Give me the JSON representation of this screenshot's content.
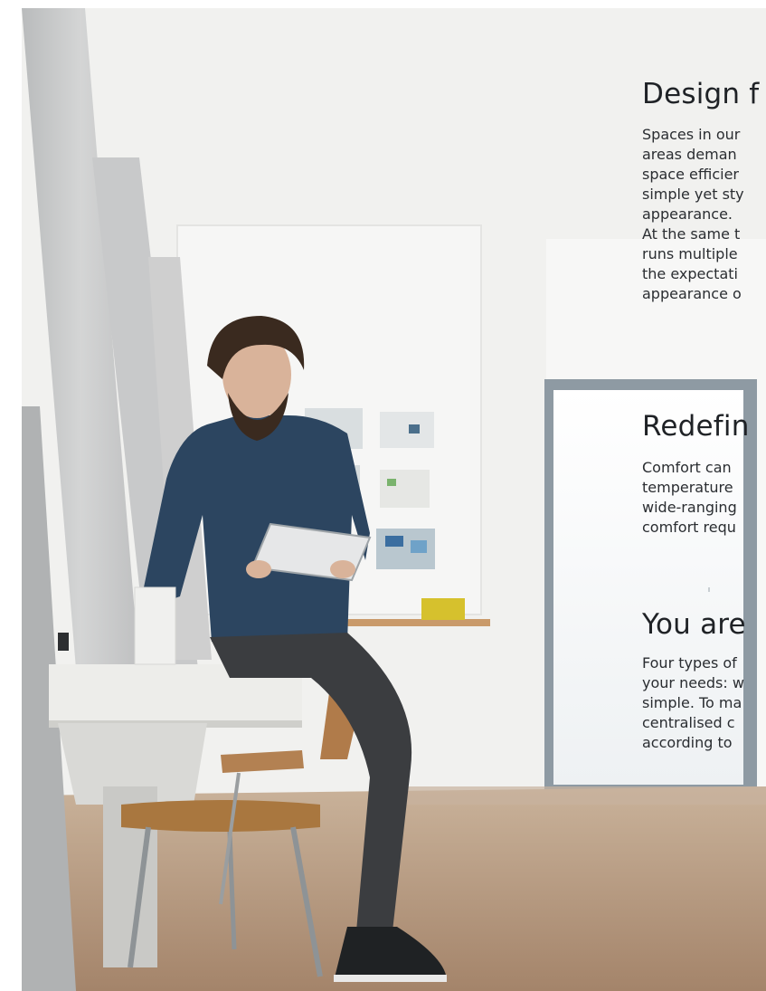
{
  "sections": [
    {
      "heading": "Design f",
      "lines": [
        "Spaces in our",
        "areas deman",
        "space efficier",
        "simple yet sty",
        "appearance.",
        "At the same t",
        "runs multiple",
        "the expectati",
        "appearance o"
      ]
    },
    {
      "heading": "Redefin",
      "lines": [
        "Comfort can",
        "temperature",
        "wide-ranging",
        "comfort requ"
      ]
    },
    {
      "heading": "You are",
      "lines": [
        "Four types of",
        "your needs: w",
        "simple. To ma",
        "centralised c",
        "according to"
      ]
    }
  ],
  "colors": {
    "text": "#1f2226",
    "wall": "#f1f1ef",
    "floor": "#b89a7f",
    "shirt": "#2c4560"
  }
}
